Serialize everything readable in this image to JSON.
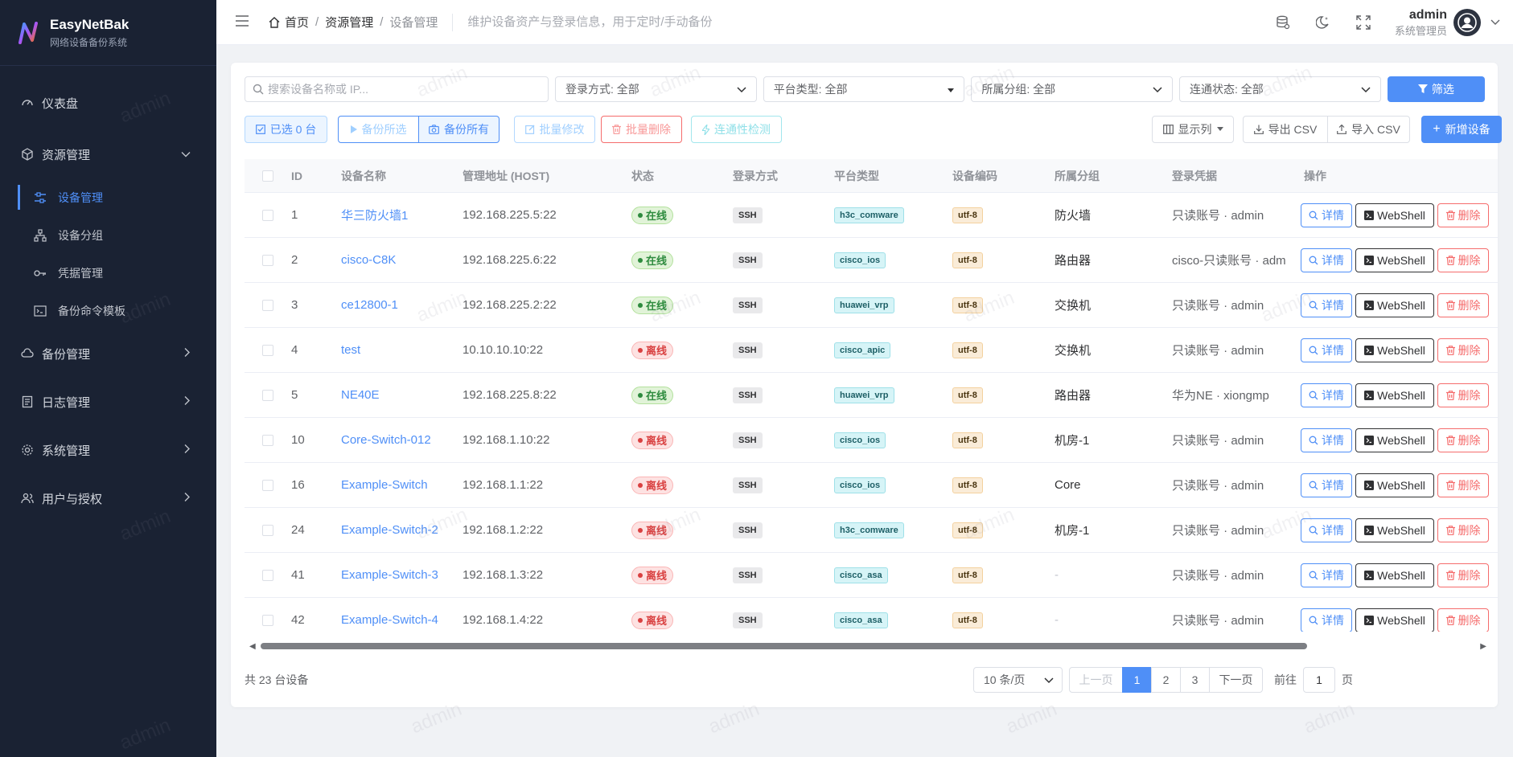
{
  "app": {
    "name": "EasyNetBak",
    "subtitle": "网络设备备份系统"
  },
  "sidebar": {
    "dashboard": "仪表盘",
    "resource": "资源管理",
    "resource_children": [
      "设备管理",
      "设备分组",
      "凭据管理",
      "备份命令模板"
    ],
    "items": [
      "备份管理",
      "日志管理",
      "系统管理",
      "用户与授权"
    ]
  },
  "header": {
    "breadcrumb": [
      "首页",
      "资源管理",
      "设备管理"
    ],
    "description": "维护设备资产与登录信息，用于定时/手动备份",
    "user_name": "admin",
    "user_role": "系统管理员"
  },
  "filters": {
    "search_placeholder": "搜索设备名称或 IP...",
    "login": "登录方式: 全部",
    "platform": "平台类型: 全部",
    "group": "所属分组: 全部",
    "connectivity": "连通状态: 全部",
    "filter_button": "筛选"
  },
  "toolbar": {
    "selected": "已选 0 台",
    "backup_selected": "备份所选",
    "backup_all": "备份所有",
    "batch_edit": "批量修改",
    "batch_delete": "批量删除",
    "conn_check": "连通性检测",
    "columns": "显示列",
    "export_csv": "导出 CSV",
    "import_csv": "导入 CSV",
    "add_device": "新增设备"
  },
  "table": {
    "headers": [
      "ID",
      "设备名称",
      "管理地址 (HOST)",
      "状态",
      "登录方式",
      "平台类型",
      "设备编码",
      "所属分组",
      "登录凭据",
      "操作"
    ],
    "actions": {
      "detail": "详情",
      "webshell": "WebShell",
      "delete": "删除"
    },
    "rows": [
      {
        "id": "1",
        "name": "华三防火墙1",
        "host": "192.168.225.5:22",
        "status": "在线",
        "online": true,
        "login": "SSH",
        "platform": "h3c_comware",
        "encoding": "utf-8",
        "group": "防火墙",
        "cred": "只读账号 · admin"
      },
      {
        "id": "2",
        "name": "cisco-C8K",
        "host": "192.168.225.6:22",
        "status": "在线",
        "online": true,
        "login": "SSH",
        "platform": "cisco_ios",
        "encoding": "utf-8",
        "group": "路由器",
        "cred": "cisco-只读账号 · adm"
      },
      {
        "id": "3",
        "name": "ce12800-1",
        "host": "192.168.225.2:22",
        "status": "在线",
        "online": true,
        "login": "SSH",
        "platform": "huawei_vrp",
        "encoding": "utf-8",
        "group": "交换机",
        "cred": "只读账号 · admin"
      },
      {
        "id": "4",
        "name": "test",
        "host": "10.10.10.10:22",
        "status": "离线",
        "online": false,
        "login": "SSH",
        "platform": "cisco_apic",
        "encoding": "utf-8",
        "group": "交换机",
        "cred": "只读账号 · admin"
      },
      {
        "id": "5",
        "name": "NE40E",
        "host": "192.168.225.8:22",
        "status": "在线",
        "online": true,
        "login": "SSH",
        "platform": "huawei_vrp",
        "encoding": "utf-8",
        "group": "路由器",
        "cred": "华为NE · xiongmp"
      },
      {
        "id": "10",
        "name": "Core-Switch-012",
        "host": "192.168.1.10:22",
        "status": "离线",
        "online": false,
        "login": "SSH",
        "platform": "cisco_ios",
        "encoding": "utf-8",
        "group": "机房-1",
        "cred": "只读账号 · admin"
      },
      {
        "id": "16",
        "name": "Example-Switch",
        "host": "192.168.1.1:22",
        "status": "离线",
        "online": false,
        "login": "SSH",
        "platform": "cisco_ios",
        "encoding": "utf-8",
        "group": "Core",
        "cred": "只读账号 · admin"
      },
      {
        "id": "24",
        "name": "Example-Switch-2",
        "host": "192.168.1.2:22",
        "status": "离线",
        "online": false,
        "login": "SSH",
        "platform": "h3c_comware",
        "encoding": "utf-8",
        "group": "机房-1",
        "cred": "只读账号 · admin"
      },
      {
        "id": "41",
        "name": "Example-Switch-3",
        "host": "192.168.1.3:22",
        "status": "离线",
        "online": false,
        "login": "SSH",
        "platform": "cisco_asa",
        "encoding": "utf-8",
        "group": "-",
        "cred": "只读账号 · admin"
      },
      {
        "id": "42",
        "name": "Example-Switch-4",
        "host": "192.168.1.4:22",
        "status": "离线",
        "online": false,
        "login": "SSH",
        "platform": "cisco_asa",
        "encoding": "utf-8",
        "group": "-",
        "cred": "只读账号 · admin"
      }
    ]
  },
  "pagination": {
    "total": "共 23 台设备",
    "page_size": "10 条/页",
    "prev": "上一页",
    "pages": [
      "1",
      "2",
      "3"
    ],
    "next": "下一页",
    "goto_label": "前往",
    "goto_value": "1",
    "goto_suffix": "页"
  },
  "watermark": "admin",
  "colors": {
    "primary": "#4f8ff7",
    "sidebar_bg": "#1a2233",
    "online": "#2e8b3e",
    "offline": "#d94141"
  }
}
